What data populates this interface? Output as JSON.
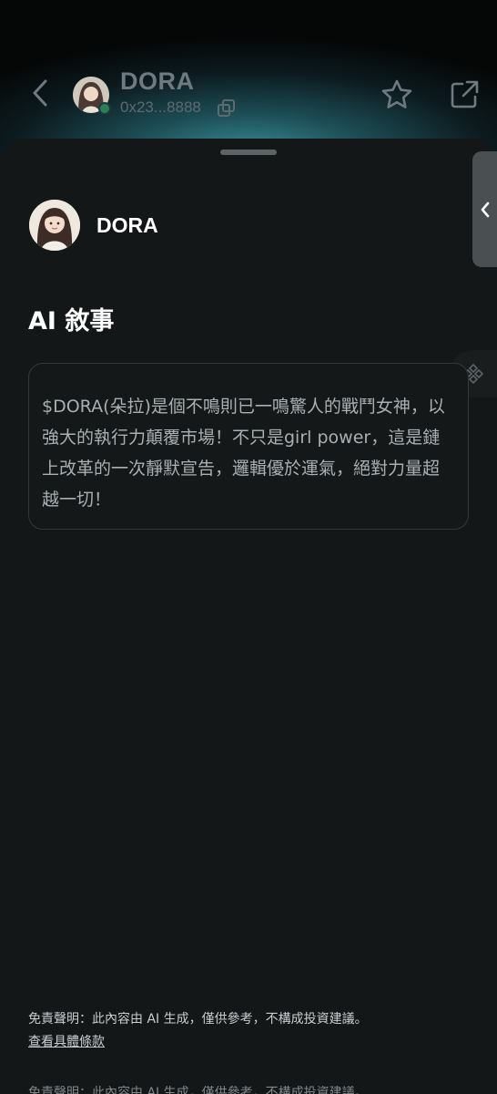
{
  "header": {
    "token_name": "DORA",
    "address": "0x23...8888",
    "back_icon": "chevron-left-icon",
    "copy_icon": "copy-icon",
    "favorite_icon": "star-outline-icon",
    "share_icon": "external-share-icon"
  },
  "profile": {
    "name": "DORA",
    "avatar_icon": "avatar-image"
  },
  "section": {
    "title": "AI 敘事"
  },
  "story": {
    "text": "$DORA(朵拉)是個不鳴則已一鳴驚人的戰鬥女神，以強大的執行力顛覆市場！不只是girl power，這是鏈上改革的一次靜默宣告，邏輯優於運氣，絕對力量超越一切！"
  },
  "footer": {
    "disclaimer": "免責聲明：此內容由 AI 生成，僅供參考，不構成投資建議。",
    "terms_link": "查看具體條款"
  },
  "colors": {
    "sheet_bg": "#141718",
    "glow": "#3a8f98",
    "story_text": "#a8b0b3"
  }
}
